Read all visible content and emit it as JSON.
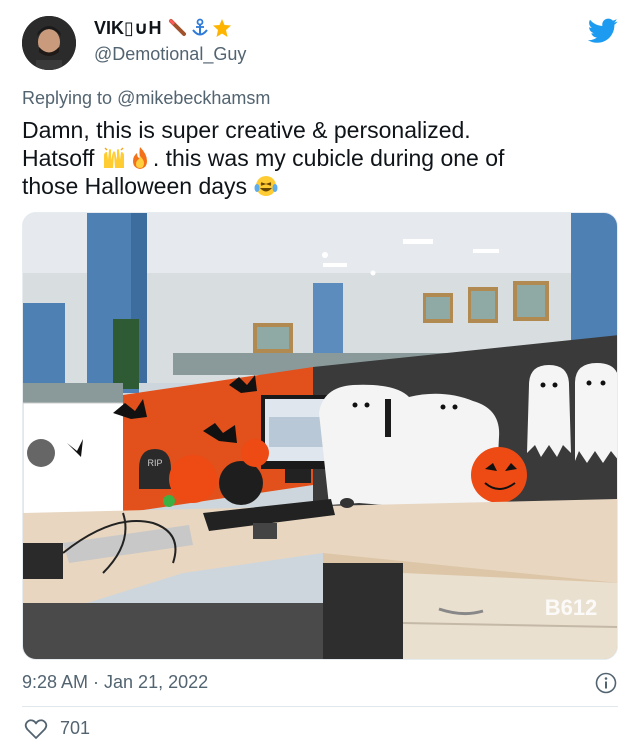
{
  "author": {
    "display_name": "VIK▯∪H",
    "handle": "@Demotional_Guy",
    "name_emojis": [
      "syringe-icon",
      "anchor-icon",
      "star-icon"
    ]
  },
  "reply": {
    "prefix": "Replying to ",
    "mention": "@mikebeckhamsm"
  },
  "tweet": {
    "line1": "Damn, this is super creative & personalized.",
    "line2_start": "Hatsoff ",
    "line2_end": ". this was my cubicle during one of",
    "line3": "those Halloween days ",
    "emojis": [
      "raised-hands-icon",
      "fire-icon",
      "laughing-tears-icon"
    ]
  },
  "photo": {
    "tombstone_text": "RIP",
    "watermark": "B612"
  },
  "meta": {
    "timestamp": "9:28 AM · Jan 21, 2022"
  },
  "stats": {
    "likes": "701"
  },
  "colors": {
    "twitter_blue": "#1d9bf0",
    "secondary_text": "#536471",
    "primary_text": "#0f1419",
    "cubicle_orange": "#e2501c"
  }
}
